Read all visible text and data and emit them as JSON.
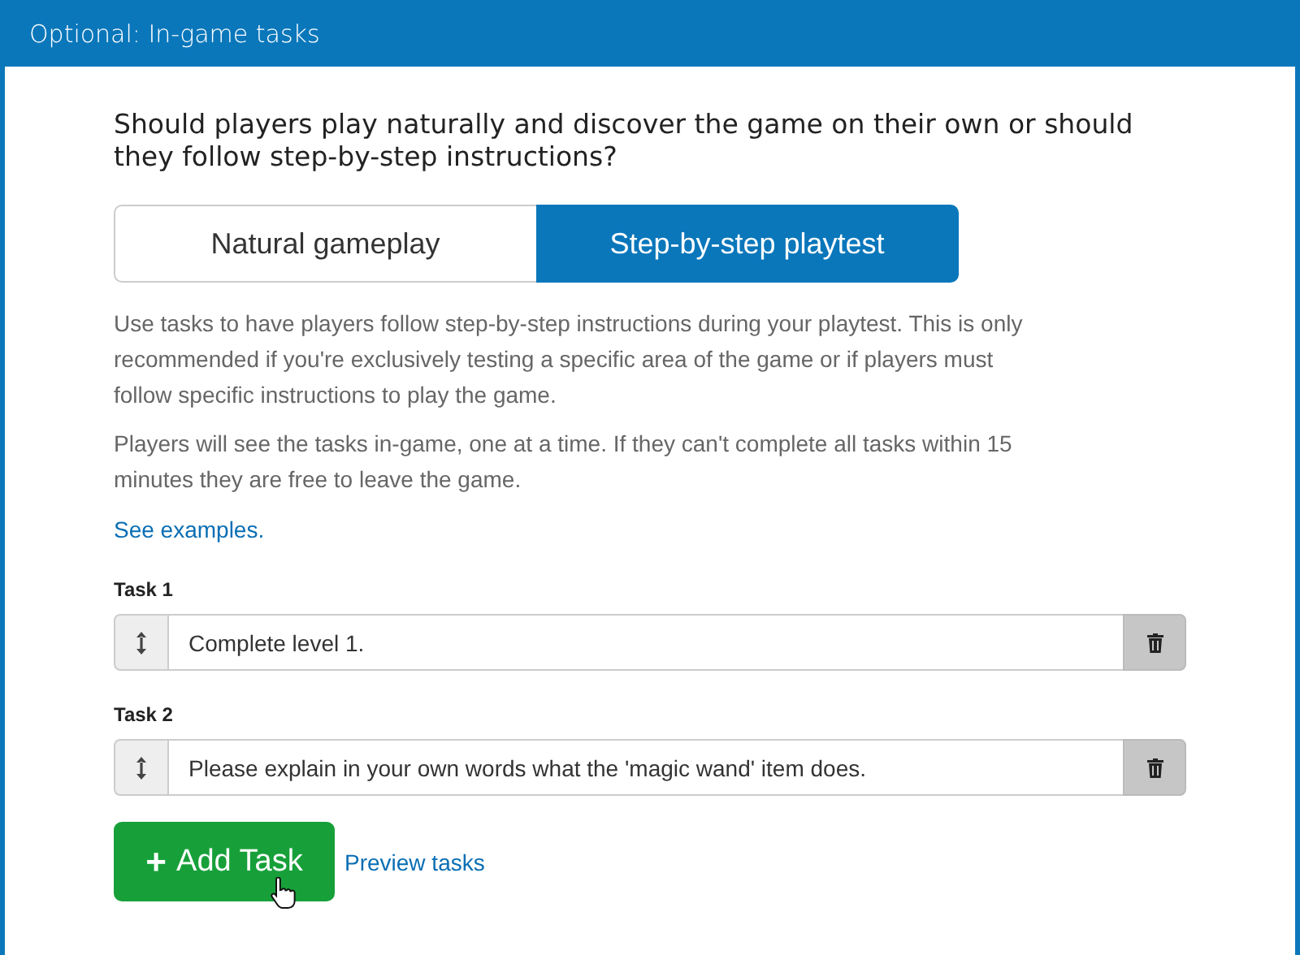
{
  "window": {
    "title": "Optional: In-game tasks"
  },
  "question": "Should players play naturally and discover the game on their own or should they follow step-by-step instructions?",
  "modes": [
    {
      "label": "Natural gameplay",
      "selected": false
    },
    {
      "label": "Step-by-step playtest",
      "selected": true
    }
  ],
  "paragraphs": [
    "Use tasks to have players follow step-by-step instructions during your playtest. This is only recommended if you're exclusively testing a specific area of the game or if players must follow specific instructions to play the game.",
    "Players will see the tasks in-game, one at a time. If they can't complete all tasks within 15 minutes they are free to leave the game."
  ],
  "examples_link": "See examples.",
  "tasks": [
    {
      "label": "Task 1",
      "value": "Complete level 1."
    },
    {
      "label": "Task 2",
      "value": "Please explain in your own words what the 'magic wand' item does."
    }
  ],
  "add_button": {
    "icon": "+",
    "label": "Add Task"
  },
  "preview_link": "Preview tasks"
}
